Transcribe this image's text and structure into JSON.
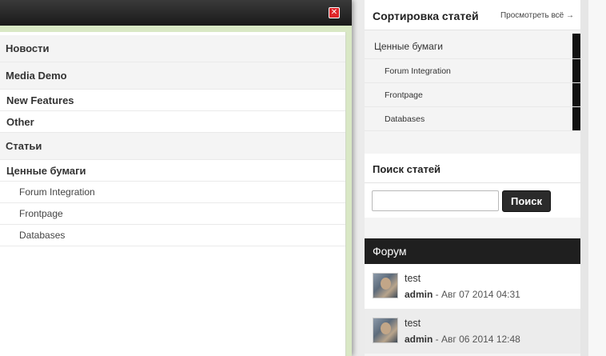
{
  "modal": {
    "close_icon": "close-icon",
    "categories": [
      {
        "label": "Новости",
        "style": "top"
      },
      {
        "label": "Media Demo",
        "style": "top"
      },
      {
        "label": "New Features",
        "style": "top-white"
      },
      {
        "label": "Other",
        "style": "top-white"
      },
      {
        "label": "Статьи",
        "style": "top"
      },
      {
        "label": "Ценные бумаги",
        "style": "top-white"
      },
      {
        "label": "Forum Integration",
        "style": "sub"
      },
      {
        "label": "Frontpage",
        "style": "sub"
      },
      {
        "label": "Databases",
        "style": "sub"
      }
    ],
    "accent_color": "#d9e8c5"
  },
  "sidebar": {
    "sort": {
      "title": "Сортировка статей",
      "view_all": "Просмотреть всё →",
      "items": [
        {
          "label": "Ценные бумаги"
        },
        {
          "label": "Forum Integration"
        },
        {
          "label": "Frontpage"
        },
        {
          "label": "Databases"
        }
      ]
    },
    "search": {
      "title": "Поиск статей",
      "input_value": "",
      "button_label": "Поиск"
    },
    "forum": {
      "title": "Форум",
      "posts": [
        {
          "topic": "test",
          "author": "admin",
          "separator": " - ",
          "date": "Авг 07 2014 04:31"
        },
        {
          "topic": "test",
          "author": "admin",
          "separator": " - ",
          "date": "Авг 06 2014 12:48"
        }
      ]
    }
  }
}
